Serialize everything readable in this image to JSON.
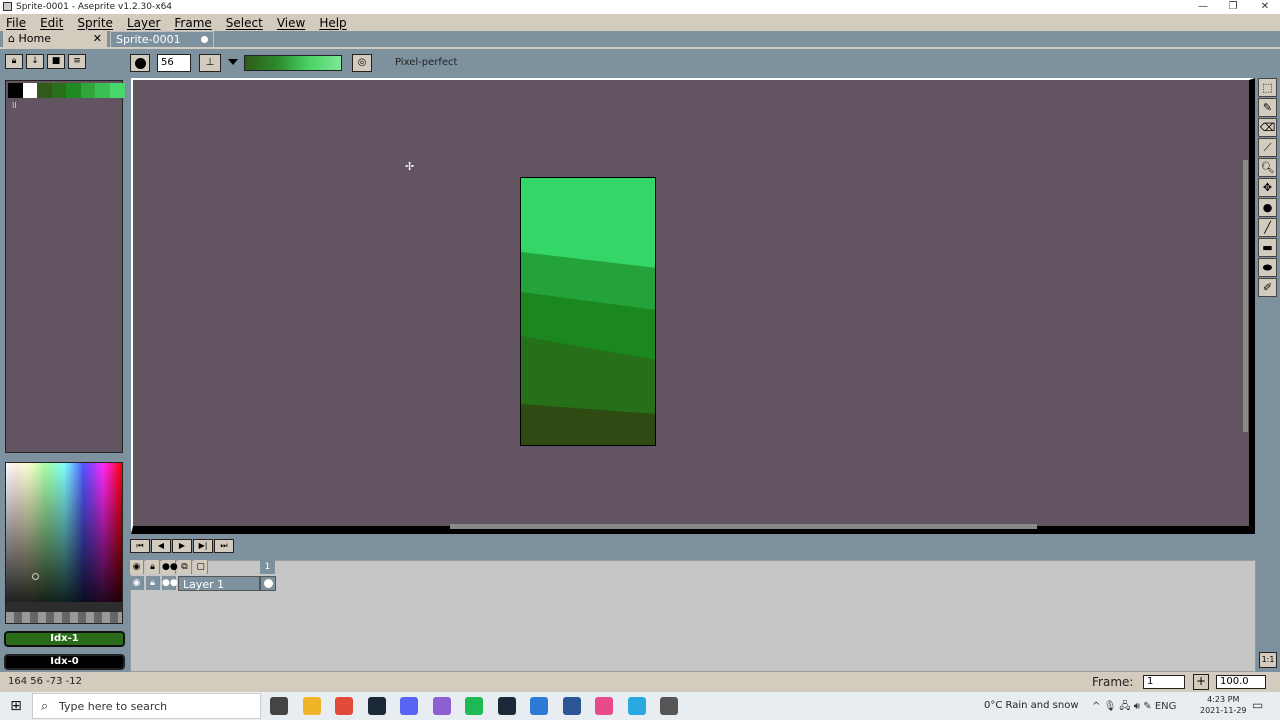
{
  "window": {
    "title": "Sprite-0001 - Aseprite v1.2.30-x64",
    "min": "—",
    "max": "❐",
    "close": "✕"
  },
  "menu": [
    "File",
    "Edit",
    "Sprite",
    "Layer",
    "Frame",
    "Select",
    "View",
    "Help"
  ],
  "tabs": [
    {
      "label": "Home",
      "close": "✕"
    },
    {
      "label": "Sprite-0001"
    }
  ],
  "context_bar": {
    "brush_size": "56",
    "pixel_perfect_label": "Pixel-perfect"
  },
  "palette": {
    "swatches": [
      "#000000",
      "#ffffff",
      "#2f5a1a",
      "#2a6f1c",
      "#1f8a23",
      "#2ea63a",
      "#3bbf55",
      "#49d66a"
    ],
    "mark": "II"
  },
  "colors": {
    "foreground_label": "Idx-1",
    "background_label": "Idx-0",
    "foreground": "#2a6b1a",
    "background": "#000000"
  },
  "sprite": {
    "bands": [
      "#35d668",
      "#24a33a",
      "#1b881f",
      "#257018",
      "#2f4a12"
    ]
  },
  "tools": [
    "rect-marquee-icon",
    "pencil-icon",
    "eraser-icon",
    "eyedropper-icon",
    "zoom-icon",
    "move-icon",
    "paint-bucket-icon",
    "line-icon",
    "rectangle-icon",
    "ellipse-icon",
    "blur-icon"
  ],
  "timeline": {
    "frame_number": "1",
    "layer_name": "Layer 1"
  },
  "status": {
    "position": "164   56    -73  -12",
    "frame_label": "Frame:",
    "frame_value": "1",
    "zoom_value": "100.0",
    "new_frame": "+",
    "zoom_reset": "1:1"
  },
  "taskbar": {
    "search_placeholder": "Type here to search",
    "weather": "0°C  Rain and snow",
    "tray_lang": "ENG",
    "time": "4:23 PM",
    "date": "2021-11-29",
    "apps": [
      "#444",
      "#f0b429",
      "#e24b3b",
      "#1b2838",
      "#5865f2",
      "#8d5fd3",
      "#1db954",
      "#1b2838",
      "#2b7bd6",
      "#2b5797",
      "#e84a8a",
      "#29a9e0",
      "#555"
    ]
  }
}
